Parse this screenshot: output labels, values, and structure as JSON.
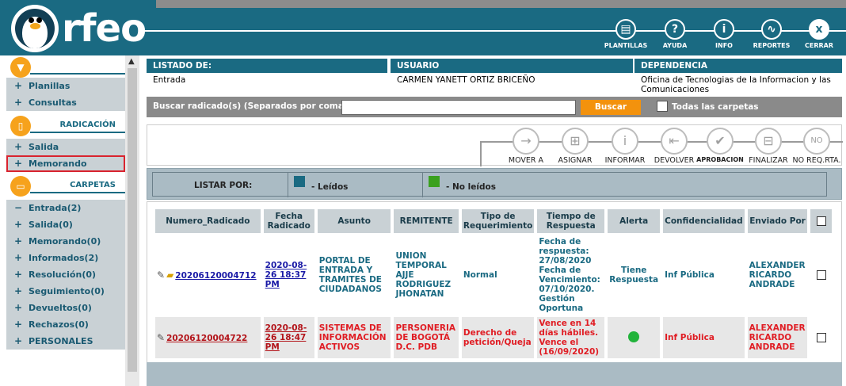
{
  "header": {
    "logo_text": "rfeo",
    "buttons": [
      {
        "label": "PLANTILLAS",
        "icon": "template-icon",
        "glyph": "▤"
      },
      {
        "label": "AYUDA",
        "icon": "help-icon",
        "glyph": "?"
      },
      {
        "label": "INFO",
        "icon": "info-icon",
        "glyph": "i"
      },
      {
        "label": "REPORTES",
        "icon": "reports-icon",
        "glyph": "∿"
      },
      {
        "label": "CERRAR",
        "icon": "close-icon",
        "glyph": "x"
      }
    ]
  },
  "sidebar": {
    "menu_top": [
      "Planillas",
      "Consultas"
    ],
    "radicacion_title": "RADICACIÓN",
    "radicacion_items": [
      "Salida",
      "Memorando"
    ],
    "carpetas_title": "CARPETAS",
    "carpetas_items": [
      {
        "label": "Entrada(2)",
        "sign": "−"
      },
      {
        "label": "Salida(0)",
        "sign": "+"
      },
      {
        "label": "Memorando(0)",
        "sign": "+"
      },
      {
        "label": "Informados(2)",
        "sign": "+"
      },
      {
        "label": "Resolución(0)",
        "sign": "+"
      },
      {
        "label": "Seguimiento(0)",
        "sign": "+"
      },
      {
        "label": "Devueltos(0)",
        "sign": "+"
      },
      {
        "label": "Rechazos(0)",
        "sign": "+"
      },
      {
        "label": "PERSONALES",
        "sign": "+"
      }
    ]
  },
  "info": {
    "listado_label": "LISTADO DE:",
    "listado_value": "Entrada",
    "usuario_label": "USUARIO",
    "usuario_value": "CARMEN YANETT ORTIZ BRICEÑO",
    "dependencia_label": "DEPENDENCIA",
    "dependencia_value": "Oficina de Tecnologias de la Informacion y las Comunicaciones"
  },
  "search": {
    "label": "Buscar radicado(s) (Separados por coma)",
    "value": "",
    "button": "Buscar",
    "all_folders_label": "Todas las carpetas"
  },
  "toolbar": [
    {
      "label": "MOVER A",
      "icon": "move-icon",
      "glyph": "→"
    },
    {
      "label": "ASIGNAR",
      "icon": "assign-icon",
      "glyph": "⊞"
    },
    {
      "label": "INFORMAR",
      "icon": "inform-icon",
      "glyph": "i"
    },
    {
      "label": "DEVOLVER",
      "icon": "return-icon",
      "glyph": "⇤"
    },
    {
      "label": "APROBACION",
      "icon": "approve-icon",
      "glyph": "✔"
    },
    {
      "label": "FINALIZAR",
      "icon": "finish-icon",
      "glyph": "⊟"
    },
    {
      "label": "NO REQ.RTA.",
      "icon": "no-response-icon",
      "glyph": "NO"
    }
  ],
  "filter": {
    "label": "LISTAR POR:",
    "leidos": "- Leídos",
    "no_leidos": "- No leídos",
    "leidos_color": "#1a6a82",
    "no_leidos_color": "#3aa11e"
  },
  "grid": {
    "headers": [
      "Numero_Radicado",
      "Fecha Radicado",
      "Asunto",
      "REMITENTE",
      "Tipo de Requerimiento",
      "Tiempo de Respuesta",
      "Alerta",
      "Confidencialidad",
      "Enviado Por"
    ],
    "rows": [
      {
        "numero": "20206120004712",
        "fecha": "2020-08-26 18:37 PM",
        "asunto": "PORTAL DE ENTRADA Y TRAMITES DE CIUDADANOS",
        "remitente": "UNION TEMPORAL AJJE RODRIGUEZ JHONATAN",
        "tipo": "Normal",
        "tiempo": "Fecha de respuesta: 27/08/2020 Fecha de Vencimiento: 07/10/2020. Gestión Oportuna",
        "alerta": "Tiene Respuesta",
        "confidencialidad": "Inf Pública",
        "enviado": "ALEXANDER RICARDO ANDRADE"
      },
      {
        "numero": "20206120004722",
        "fecha": "2020-08-26 18:47 PM",
        "asunto": "SISTEMAS DE INFORMACIÓN ACTIVOS",
        "remitente": "PERSONERIA DE BOGOTÁ D.C. PDB",
        "tipo": "Derecho de petición/Queja",
        "tiempo": "Vence en 14 días hábiles. Vence el (16/09/2020)",
        "alerta": "",
        "confidencialidad": "Inf Pública",
        "enviado": "ALEXANDER RICARDO ANDRADE"
      }
    ]
  }
}
